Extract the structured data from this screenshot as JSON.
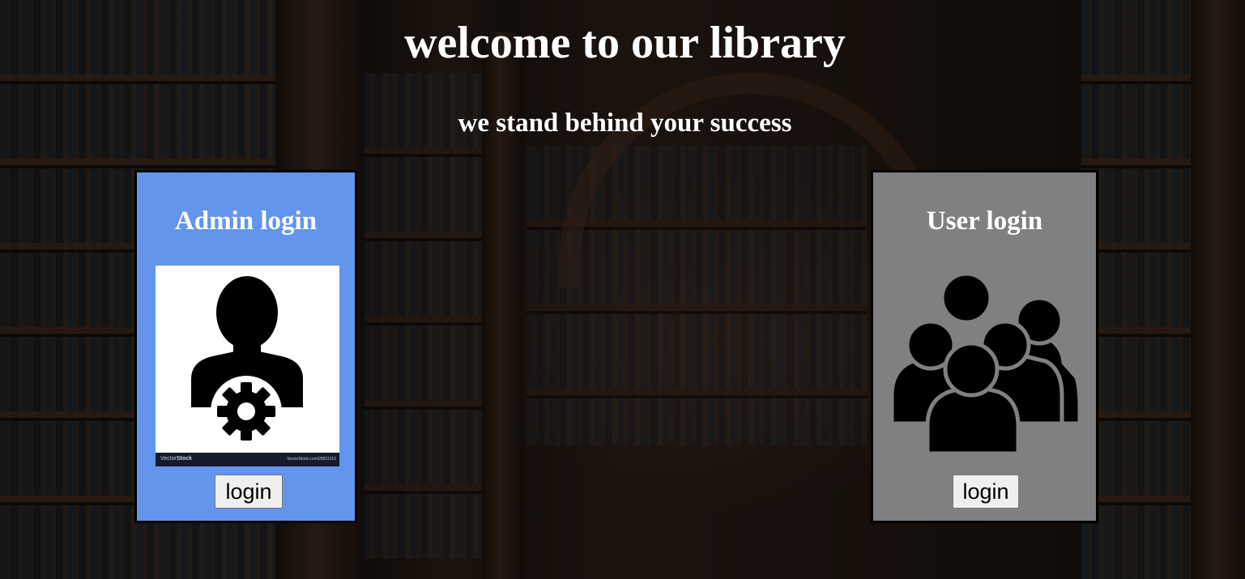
{
  "header": {
    "title": "welcome to our library",
    "subtitle": "we stand behind your success"
  },
  "admin_panel": {
    "title": "Admin login",
    "image_icon": "admin-gear-user-icon",
    "watermark_left_prefix": "Vector",
    "watermark_left_brand": "Stock",
    "watermark_right": "VectorStock.com/25811310",
    "button_label": "login",
    "background_color": "#6495ed"
  },
  "user_panel": {
    "title": "User login",
    "image_icon": "user-group-icon",
    "button_label": "login",
    "background_color": "#808080"
  }
}
